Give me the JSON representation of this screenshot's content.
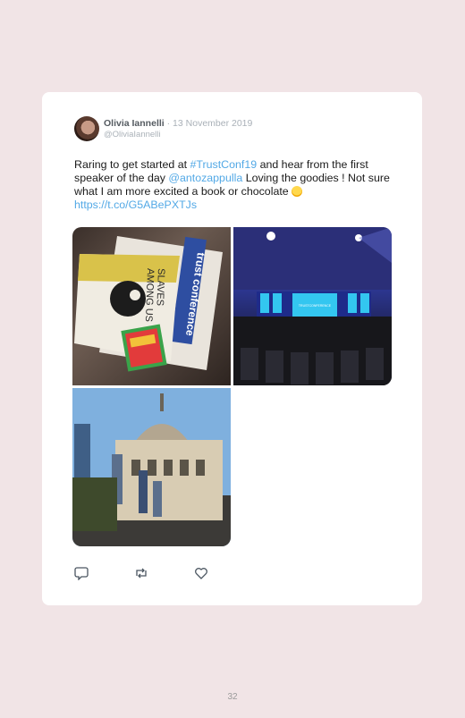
{
  "tweet": {
    "author_name": "Olivia Iannelli",
    "separator": " · ",
    "date": "13 November 2019",
    "handle": "@OliviaIannelli",
    "text": {
      "part1": "Raring to get started at ",
      "hashtag": "#TrustConf19",
      "part2": " and hear from the first speaker of the day ",
      "mention": "@antozappulla",
      "part3": " Loving the goodies ! Not sure what I am more excited a book or chocolate ",
      "url": "https://t.co/G5ABePXTJs"
    },
    "book_cover": {
      "line1": "trust conference",
      "line2": "SLAVES",
      "line3": "AMONG US"
    },
    "stage_screen_text": "TRUSTCONFERENCE"
  },
  "footer": {
    "page_number": "32"
  },
  "colors": {
    "background": "#f1e4e6",
    "card": "#ffffff",
    "link": "#53a9e6",
    "name": "#555b61",
    "muted": "#aab1b8"
  },
  "icons": [
    "reply-icon",
    "retweet-icon",
    "like-icon"
  ]
}
